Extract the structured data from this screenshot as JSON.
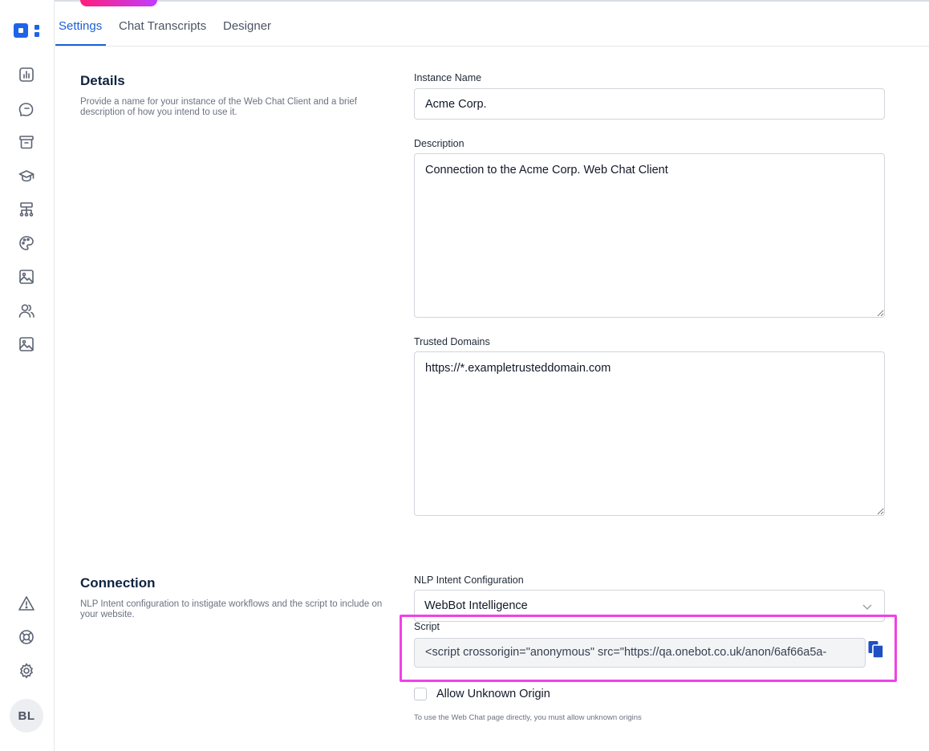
{
  "tabs": [
    {
      "label": "Settings",
      "active": true
    },
    {
      "label": "Chat Transcripts",
      "active": false
    },
    {
      "label": "Designer",
      "active": false
    }
  ],
  "sidebar": {
    "icons": [
      "chart-icon",
      "chat-bubbles-icon",
      "archive-icon",
      "graduation-cap-icon",
      "flow-icon",
      "palette-icon",
      "image-icon",
      "users-icon",
      "image-icon"
    ],
    "bottom_icons": [
      "warning-icon",
      "help-lifebuoy-icon",
      "gear-icon"
    ],
    "avatar_initials": "BL"
  },
  "details": {
    "title": "Details",
    "description": "Provide a name for your instance of the Web Chat Client and a brief description of how you intend to use it.",
    "instance_name_label": "Instance Name",
    "instance_name_value": "Acme Corp.",
    "description_label": "Description",
    "description_value": "Connection to the Acme Corp. Web Chat Client",
    "trusted_domains_label": "Trusted Domains",
    "trusted_domains_value": "https://*.exampletrusteddomain.com"
  },
  "connection": {
    "title": "Connection",
    "description": "NLP Intent configuration to instigate workflows and the script to include on your website.",
    "nlp_label": "NLP Intent Configuration",
    "nlp_value": "WebBot Intelligence",
    "script_label": "Script",
    "script_value": "<script crossorigin=\"anonymous\" src=\"https://qa.onebot.co.uk/anon/6af66a5a-",
    "allow_unknown_label": "Allow Unknown Origin",
    "allow_unknown_checked": false,
    "hint": "To use the Web Chat page directly, you must allow unknown origins"
  },
  "colors": {
    "accent": "#1e5fd6",
    "highlight": "#f33fe8",
    "brand": "#1e63e9"
  }
}
